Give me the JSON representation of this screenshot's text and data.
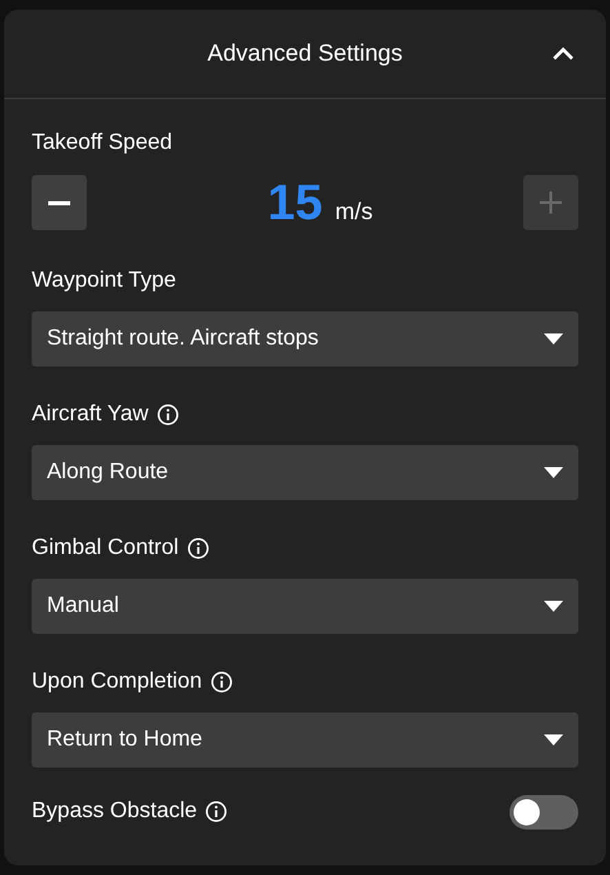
{
  "panel": {
    "title": "Advanced Settings",
    "expanded": true
  },
  "takeoff_speed": {
    "label": "Takeoff Speed",
    "value": "15",
    "unit": "m/s",
    "decrement": {
      "disabled": false
    },
    "increment": {
      "disabled": true
    }
  },
  "settings": [
    {
      "kind": "dropdown",
      "label": "Waypoint Type",
      "info": false,
      "value": "Straight route. Aircraft stops"
    },
    {
      "kind": "dropdown",
      "label": "Aircraft Yaw",
      "info": true,
      "value": "Along Route"
    },
    {
      "kind": "dropdown",
      "label": "Gimbal Control",
      "info": true,
      "value": "Manual"
    },
    {
      "kind": "dropdown",
      "label": "Upon Completion",
      "info": true,
      "value": "Return to Home"
    },
    {
      "kind": "toggle",
      "label": "Bypass Obstacle",
      "info": true,
      "on": false
    }
  ]
}
